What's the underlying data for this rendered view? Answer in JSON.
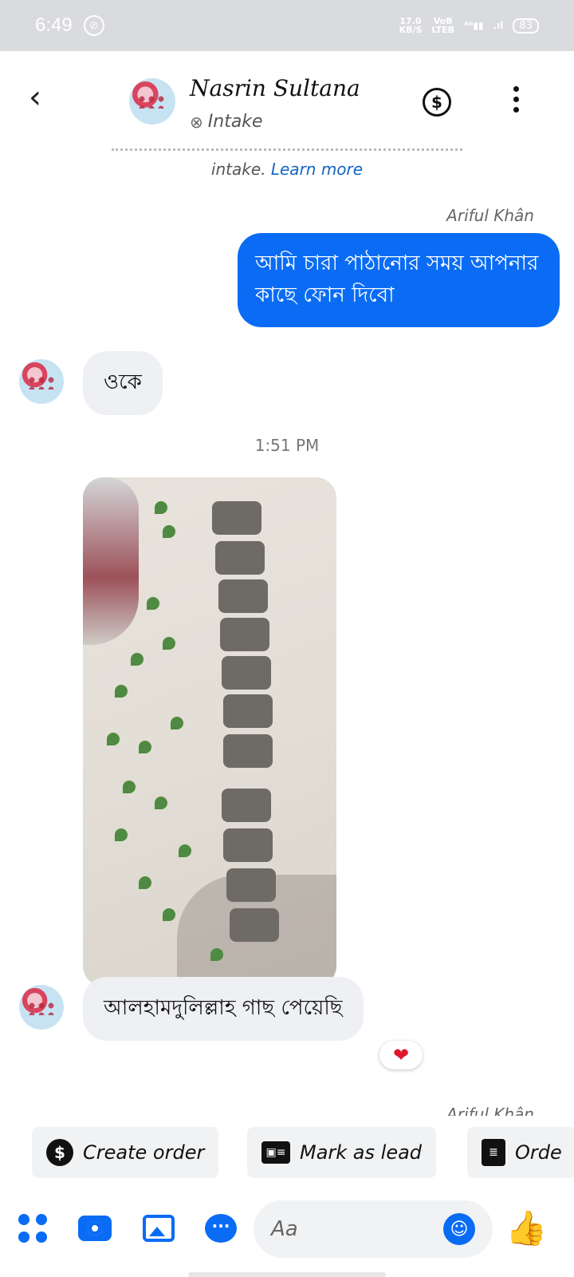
{
  "status_bar": {
    "time": "6:49",
    "speed_top": "17.0",
    "speed_bottom": "KB/S",
    "volte_top": "VoB",
    "volte_bottom": "LTEB",
    "signal1": "⁴ᴳ▮▮",
    "signal2": ".ıl",
    "battery": "83"
  },
  "header": {
    "back_icon": "chevron-left-icon",
    "contact_name": "Nasrin Sultana",
    "contact_stage": "Intake",
    "stage_icon": "intake-icon",
    "dollar_icon": "dollar-icon",
    "more_icon": "more-vertical-icon"
  },
  "info": {
    "text": "intake.",
    "link": "Learn more"
  },
  "messages": {
    "sender_name": "Ariful Khân",
    "outgoing_text": "আমি চারা পাঠানোর সময় আপনার কাছে ফোন দিবো",
    "incoming_1": "ওকে",
    "timestamp": "1:51 PM",
    "incoming_2": "আলহামদুলিল্লাহ গাছ পেয়েছি",
    "reaction": "❤",
    "sender_name_2": "Ariful Khân"
  },
  "actions": {
    "create_order": "Create order",
    "mark_as_lead": "Mark as lead",
    "orders": "Orde"
  },
  "composer": {
    "placeholder": "Aa"
  },
  "colors": {
    "accent": "#0a6cf4",
    "incoming_bubble": "#eef0f3",
    "status_bar": "#dadbdf"
  }
}
